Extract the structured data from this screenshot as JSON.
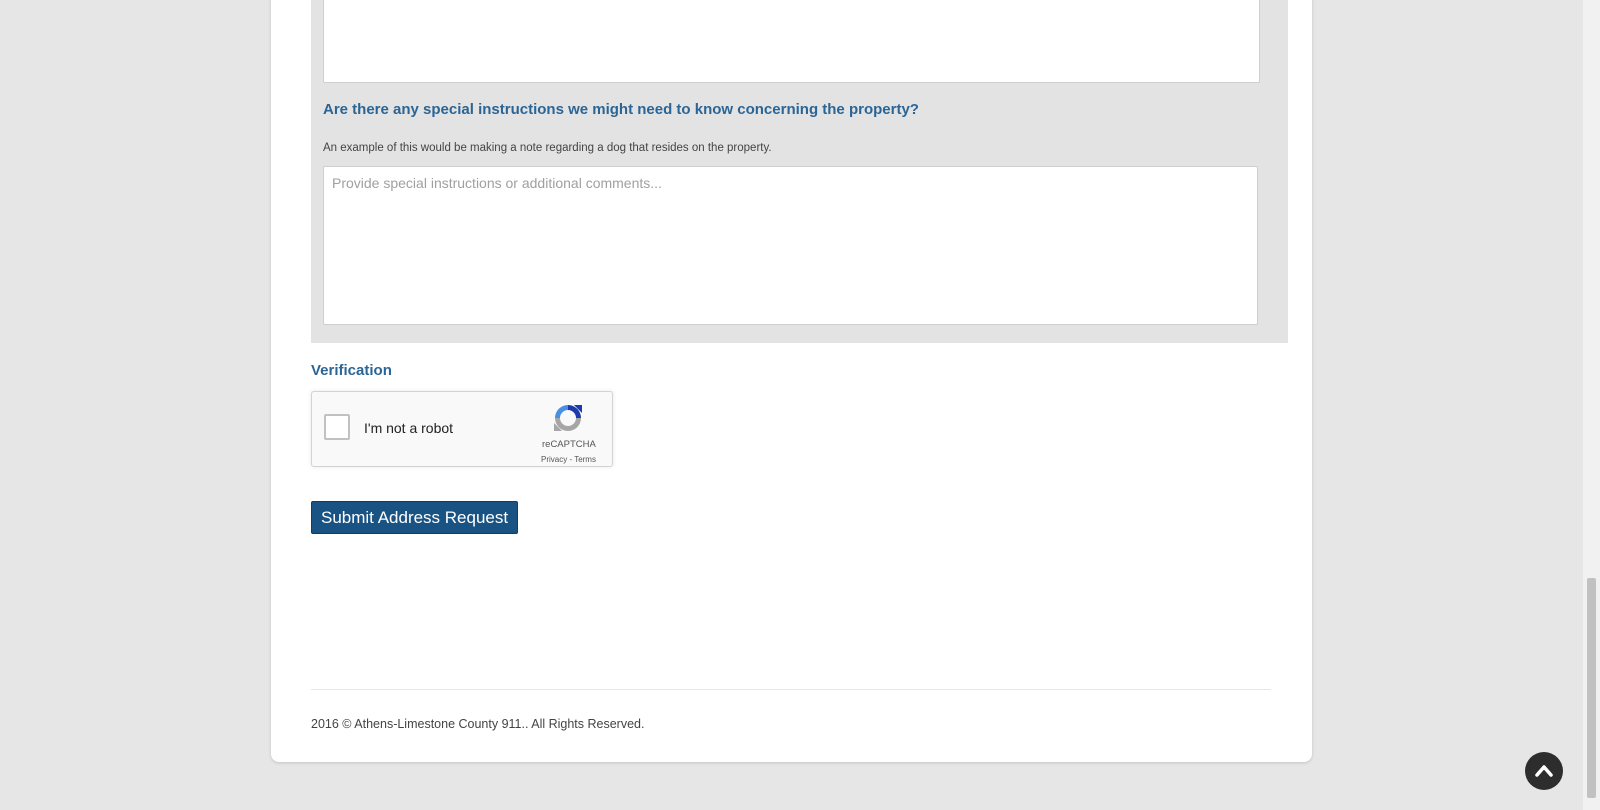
{
  "form": {
    "special_instructions_question": "Are there any special instructions we might need to know concerning the property?",
    "special_instructions_help": "An example of this would be making a note regarding a dog that resides on the property.",
    "special_instructions_placeholder": "Provide special instructions or additional comments..."
  },
  "verification": {
    "label": "Verification",
    "recaptcha_label": "I'm not a robot",
    "recaptcha_brand": "reCAPTCHA",
    "recaptcha_links": "Privacy - Terms"
  },
  "submit_label": "Submit Address Request",
  "footer": {
    "copyright": "2016 © Athens-Limestone County 911.. All Rights Reserved."
  },
  "colors": {
    "accent": "#2b6596",
    "button": "#195384",
    "panel": "#e3e3e3",
    "background": "#e6e6e6"
  },
  "icons": {
    "scroll_top": "chevron-up-icon",
    "recaptcha_logo": "recaptcha-logo-icon"
  }
}
